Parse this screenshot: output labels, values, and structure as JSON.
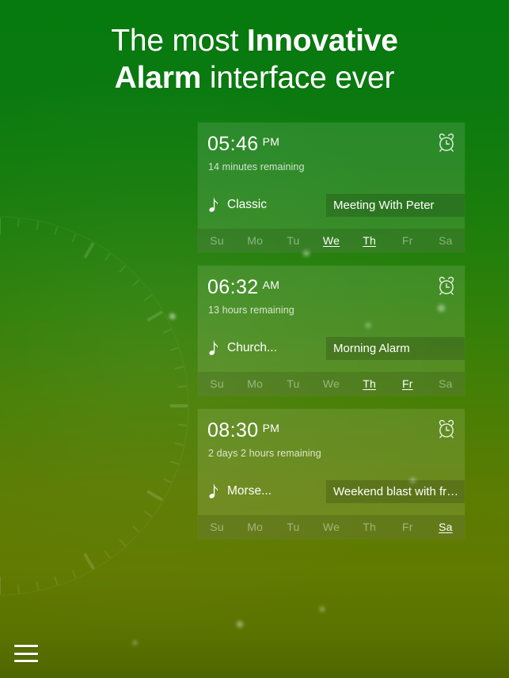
{
  "headline": {
    "part1": "The most ",
    "bold1": "Innovative",
    "mid": " ",
    "bold2": "Alarm",
    "part2": " interface ever"
  },
  "colors": {
    "background_top": "#067a0e",
    "background_bottom": "#4e6600",
    "card_fill": "rgba(255,255,255,0.115)",
    "day_strip": "rgba(0,0,0,0.115)",
    "label_box": "rgba(0,0,0,0.155)",
    "text": "#ffffff"
  },
  "day_names": [
    "Su",
    "Mo",
    "Tu",
    "We",
    "Th",
    "Fr",
    "Sa"
  ],
  "alarms": [
    {
      "time": "05:46",
      "ampm": "PM",
      "remaining": "14 minutes remaining",
      "tone": "Classic",
      "label": "Meeting With Peter",
      "alarm_icon": "alarm-clock-icon",
      "tone_icon": "music-note-icon",
      "days": [
        {
          "name": "Su",
          "active": false
        },
        {
          "name": "Mo",
          "active": false
        },
        {
          "name": "Tu",
          "active": false
        },
        {
          "name": "We",
          "active": true
        },
        {
          "name": "Th",
          "active": true
        },
        {
          "name": "Fr",
          "active": false
        },
        {
          "name": "Sa",
          "active": false
        }
      ]
    },
    {
      "time": "06:32",
      "ampm": "AM",
      "remaining": "13 hours remaining",
      "tone": "Church...",
      "label": "Morning Alarm",
      "alarm_icon": "alarm-clock-icon",
      "tone_icon": "music-note-icon",
      "days": [
        {
          "name": "Su",
          "active": false
        },
        {
          "name": "Mo",
          "active": false
        },
        {
          "name": "Tu",
          "active": false
        },
        {
          "name": "We",
          "active": false
        },
        {
          "name": "Th",
          "active": true
        },
        {
          "name": "Fr",
          "active": true
        },
        {
          "name": "Sa",
          "active": false
        }
      ]
    },
    {
      "time": "08:30",
      "ampm": "PM",
      "remaining": "2 days 2 hours remaining",
      "tone": "Morse...",
      "label": "Weekend blast with fr…",
      "alarm_icon": "alarm-clock-icon",
      "tone_icon": "music-note-icon",
      "days": [
        {
          "name": "Su",
          "active": false
        },
        {
          "name": "Mo",
          "active": false
        },
        {
          "name": "Tu",
          "active": false
        },
        {
          "name": "We",
          "active": false
        },
        {
          "name": "Th",
          "active": false
        },
        {
          "name": "Fr",
          "active": false
        },
        {
          "name": "Sa",
          "active": true
        }
      ]
    }
  ],
  "menu": {
    "icon": "hamburger-menu-icon",
    "label": "Menu"
  }
}
